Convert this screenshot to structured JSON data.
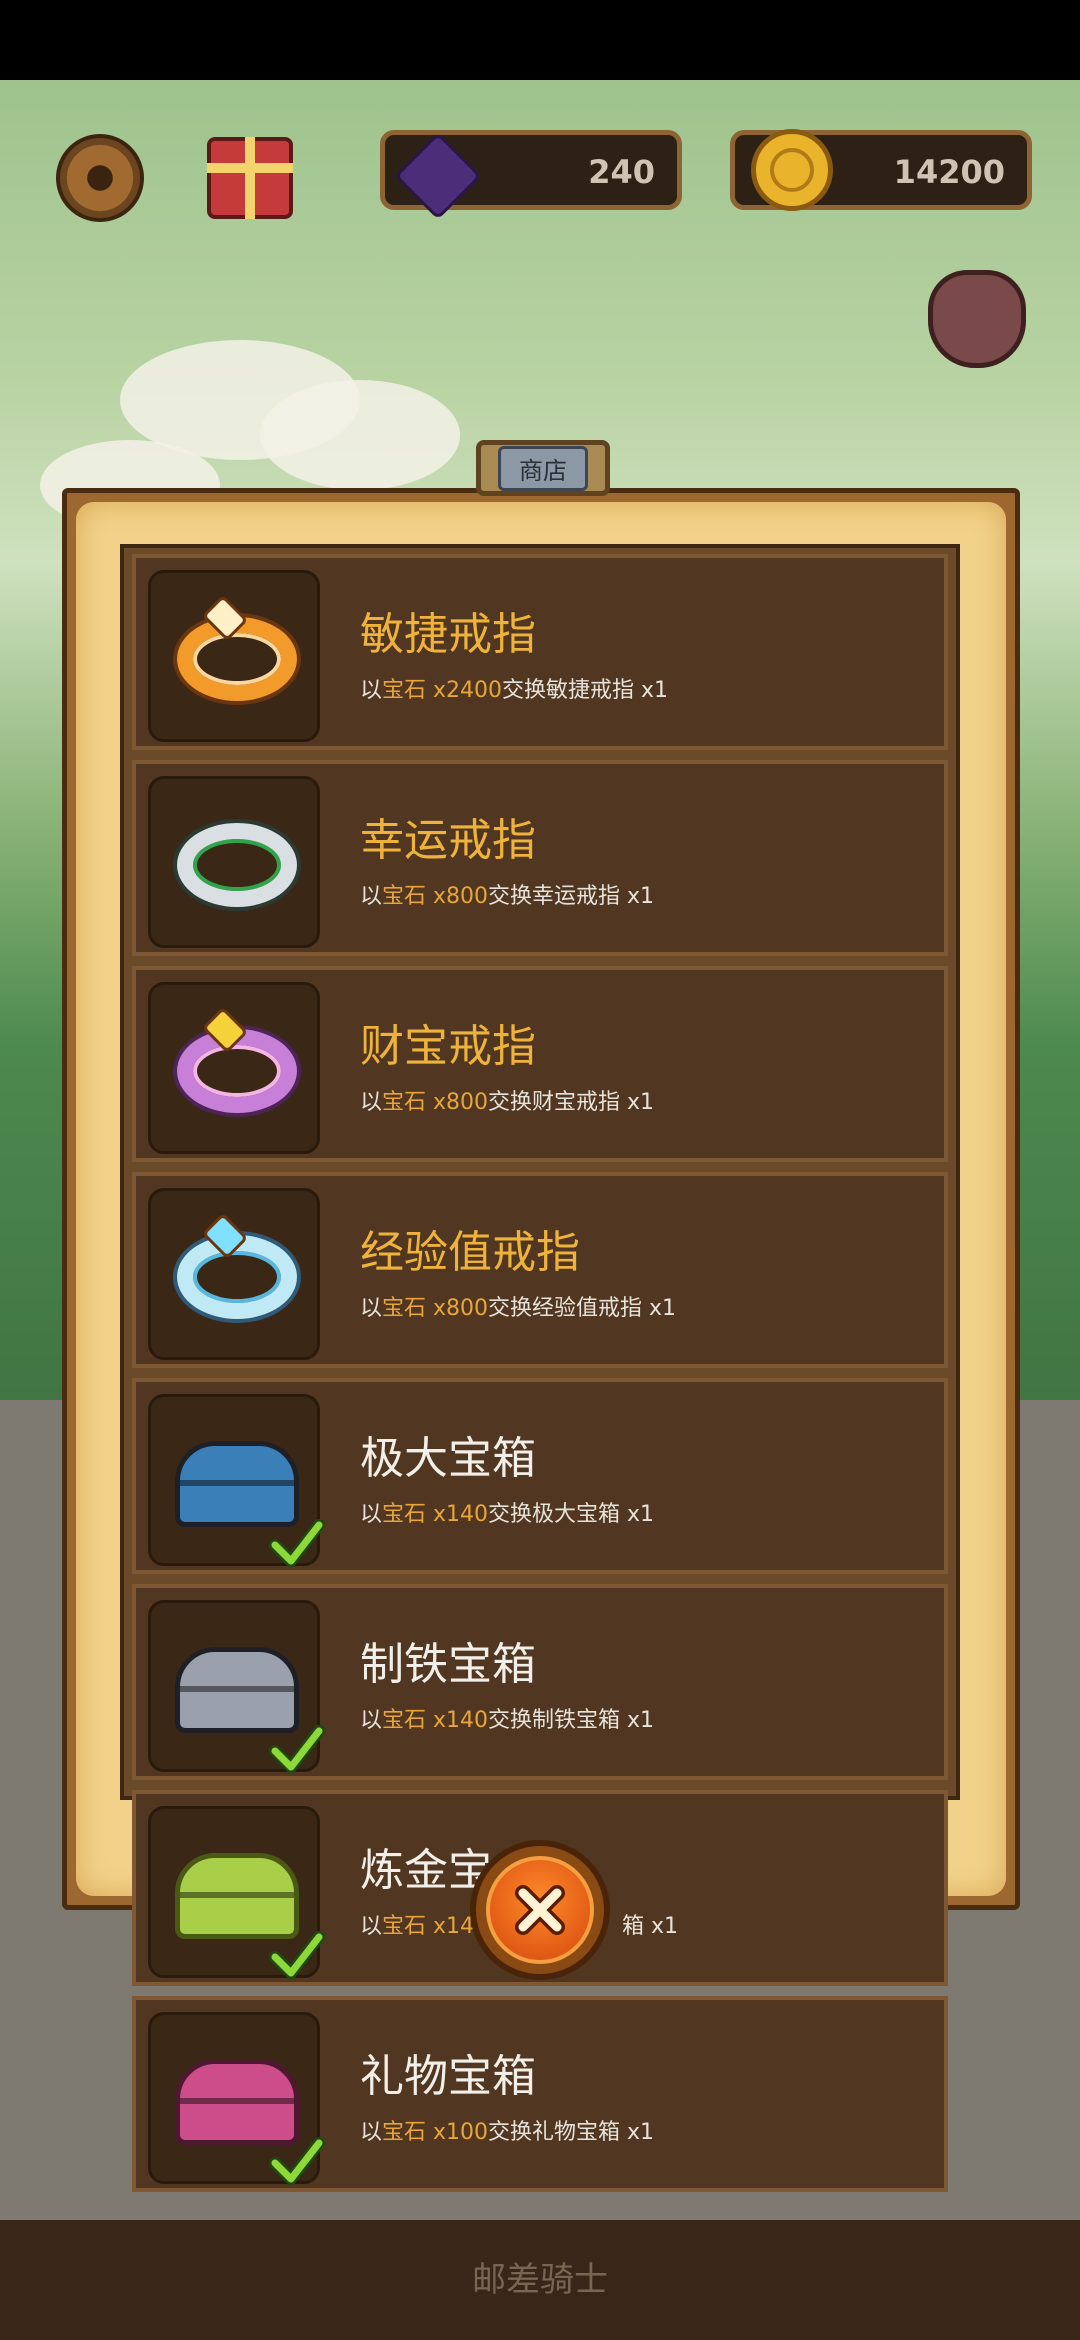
{
  "hud": {
    "gems": "240",
    "coins": "14200"
  },
  "shop": {
    "tab_label": "商店",
    "items": [
      {
        "name": "敏捷戒指",
        "prefix": "以",
        "currency": "宝石",
        "cost": " x2400",
        "suffix": "交换敏捷戒指 x1",
        "icon": "orange-ring-icon",
        "owned": false
      },
      {
        "name": "幸运戒指",
        "prefix": "以",
        "currency": "宝石",
        "cost": " x800",
        "suffix": "交换幸运戒指 x1",
        "icon": "green-ring-icon",
        "owned": false
      },
      {
        "name": "财宝戒指",
        "prefix": "以",
        "currency": "宝石",
        "cost": " x800",
        "suffix": "交换财宝戒指 x1",
        "icon": "pink-ring-icon",
        "owned": false
      },
      {
        "name": "经验值戒指",
        "prefix": "以",
        "currency": "宝石",
        "cost": " x800",
        "suffix": "交换经验值戒指 x1",
        "icon": "winged-ring-icon",
        "owned": false
      },
      {
        "name": "极大宝箱",
        "prefix": "以",
        "currency": "宝石",
        "cost": " x140",
        "suffix": "交换极大宝箱 x1",
        "icon": "blue-chest-icon",
        "owned": true
      },
      {
        "name": "制铁宝箱",
        "prefix": "以",
        "currency": "宝石",
        "cost": " x140",
        "suffix": "交换制铁宝箱 x1",
        "icon": "iron-chest-icon",
        "owned": true
      },
      {
        "name": "炼金宝",
        "prefix": "以",
        "currency": "宝石",
        "cost": " x14",
        "suffix": "箱 x1",
        "icon": "gold-chest-icon",
        "owned": true
      },
      {
        "name": "礼物宝箱",
        "prefix": "以",
        "currency": "宝石",
        "cost": " x100",
        "suffix": "交换礼物宝箱 x1",
        "icon": "pink-chest-icon",
        "owned": true
      }
    ]
  },
  "footer": {
    "title": "邮差骑士"
  }
}
